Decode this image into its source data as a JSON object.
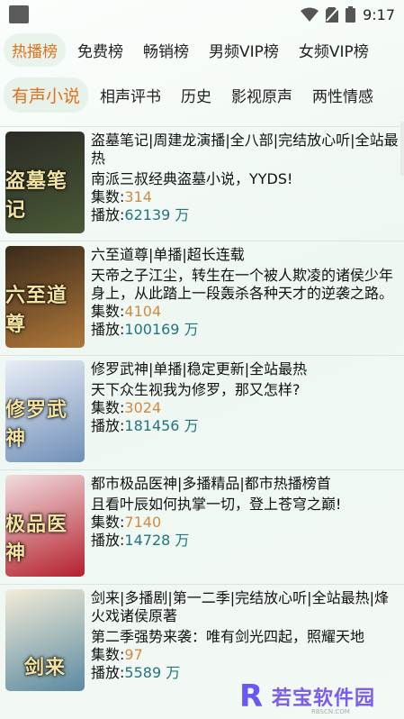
{
  "status": {
    "time": "9:17"
  },
  "tabs_row1": [
    "热播榜",
    "免费榜",
    "畅销榜",
    "男频VIP榜",
    "女频VIP榜"
  ],
  "tabs_row2": [
    "有声小说",
    "相声评书",
    "历史",
    "影视原声",
    "两性情感"
  ],
  "labels": {
    "episodes": "集数:",
    "plays": "播放:"
  },
  "items": [
    {
      "cover_text": "盗墓笔记",
      "cover_color_a": "#2b2b26",
      "cover_color_b": "#4a5a36",
      "title": "盗墓笔记|周建龙演播|全八部|完结放心听|全站最热",
      "desc": "南派三叔经典盗墓小说，YYDS!",
      "episodes": "314",
      "plays": "62139 万"
    },
    {
      "cover_text": "六至道尊",
      "cover_color_a": "#3a2a1a",
      "cover_color_b": "#b0783a",
      "title": "六至道尊|单播|超长连载",
      "desc": "天帝之子江尘，转生在一个被人欺凌的诸侯少年身上，从此踏上一段轰杀各种天才的逆袭之路。",
      "episodes": "4104",
      "plays": "100169 万"
    },
    {
      "cover_text": "修罗武神",
      "cover_color_a": "#e9eef6",
      "cover_color_b": "#6f8fb8",
      "title": "修罗武神|单播|稳定更新|全站最热",
      "desc": "天下众生视我为修罗，那又怎样?",
      "episodes": "3024",
      "plays": "181456 万"
    },
    {
      "cover_text": "极品医神",
      "cover_color_a": "#f0dde0",
      "cover_color_b": "#b5202c",
      "title": "都市极品医神|多播精品|都市热播榜首",
      "desc": "且看叶辰如何执掌一切，登上苍穹之巅!",
      "episodes": "7140",
      "plays": "14728 万"
    },
    {
      "cover_text": "剑来",
      "cover_color_a": "#f3ecd8",
      "cover_color_b": "#5a8aa0",
      "title": "剑来|多播剧|第一二季|完结放心听|全站最热|烽火戏诸侯原著",
      "desc": "第二季强势来袭：唯有剑光四起，照耀天地",
      "episodes": "97",
      "plays": "5589 万"
    }
  ],
  "watermark": {
    "logo": "R",
    "text": "若宝软件园",
    "sub": "RBSCN.COM"
  }
}
